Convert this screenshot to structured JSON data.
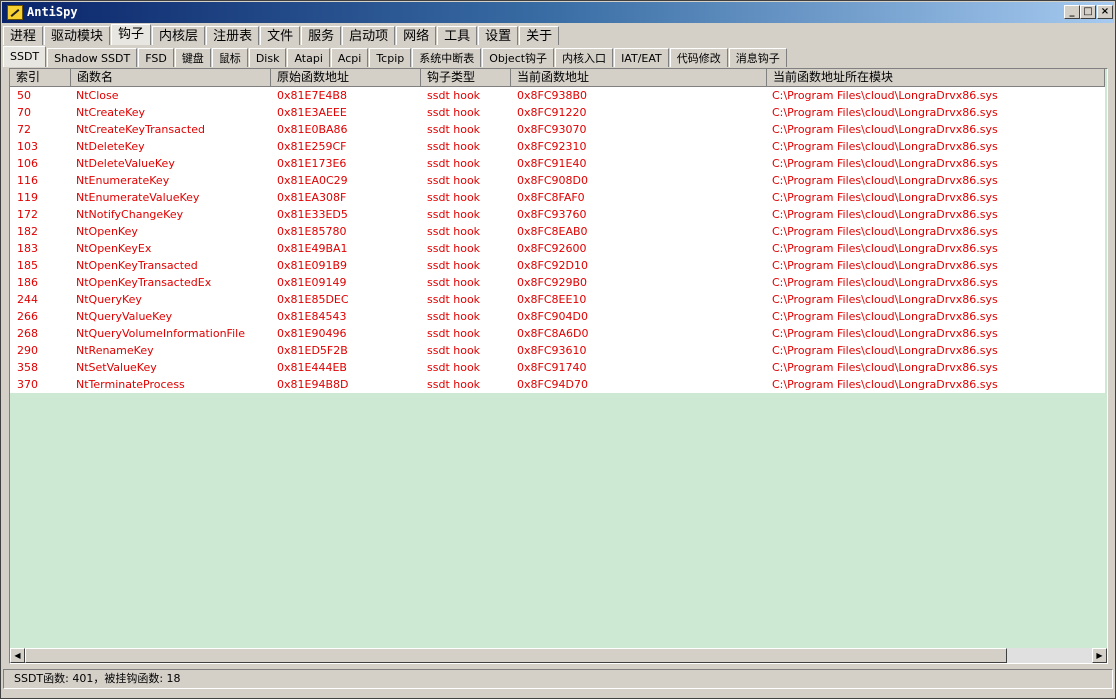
{
  "window": {
    "title": "AntiSpy"
  },
  "main_tabs": [
    {
      "label": "进程"
    },
    {
      "label": "驱动模块"
    },
    {
      "label": "钩子",
      "active": true
    },
    {
      "label": "内核层"
    },
    {
      "label": "注册表"
    },
    {
      "label": "文件"
    },
    {
      "label": "服务"
    },
    {
      "label": "启动项"
    },
    {
      "label": "网络"
    },
    {
      "label": "工具"
    },
    {
      "label": "设置"
    },
    {
      "label": "关于"
    }
  ],
  "sub_tabs": [
    {
      "label": "SSDT",
      "active": true
    },
    {
      "label": "Shadow SSDT"
    },
    {
      "label": "FSD"
    },
    {
      "label": "键盘"
    },
    {
      "label": "鼠标"
    },
    {
      "label": "Disk"
    },
    {
      "label": "Atapi"
    },
    {
      "label": "Acpi"
    },
    {
      "label": "Tcpip"
    },
    {
      "label": "系统中断表"
    },
    {
      "label": "Object钩子"
    },
    {
      "label": "内核入口"
    },
    {
      "label": "IAT/EAT"
    },
    {
      "label": "代码修改"
    },
    {
      "label": "消息钩子"
    }
  ],
  "table": {
    "columns": [
      "索引",
      "函数名",
      "原始函数地址",
      "钩子类型",
      "当前函数地址",
      "当前函数地址所在模块"
    ],
    "rows": [
      [
        "50",
        "NtClose",
        "0x81E7E4B8",
        "ssdt hook",
        "0x8FC938B0",
        "C:\\Program Files\\cloud\\LongraDrvx86.sys"
      ],
      [
        "70",
        "NtCreateKey",
        "0x81E3AEEE",
        "ssdt hook",
        "0x8FC91220",
        "C:\\Program Files\\cloud\\LongraDrvx86.sys"
      ],
      [
        "72",
        "NtCreateKeyTransacted",
        "0x81E0BA86",
        "ssdt hook",
        "0x8FC93070",
        "C:\\Program Files\\cloud\\LongraDrvx86.sys"
      ],
      [
        "103",
        "NtDeleteKey",
        "0x81E259CF",
        "ssdt hook",
        "0x8FC92310",
        "C:\\Program Files\\cloud\\LongraDrvx86.sys"
      ],
      [
        "106",
        "NtDeleteValueKey",
        "0x81E173E6",
        "ssdt hook",
        "0x8FC91E40",
        "C:\\Program Files\\cloud\\LongraDrvx86.sys"
      ],
      [
        "116",
        "NtEnumerateKey",
        "0x81EA0C29",
        "ssdt hook",
        "0x8FC908D0",
        "C:\\Program Files\\cloud\\LongraDrvx86.sys"
      ],
      [
        "119",
        "NtEnumerateValueKey",
        "0x81EA308F",
        "ssdt hook",
        "0x8FC8FAF0",
        "C:\\Program Files\\cloud\\LongraDrvx86.sys"
      ],
      [
        "172",
        "NtNotifyChangeKey",
        "0x81E33ED5",
        "ssdt hook",
        "0x8FC93760",
        "C:\\Program Files\\cloud\\LongraDrvx86.sys"
      ],
      [
        "182",
        "NtOpenKey",
        "0x81E85780",
        "ssdt hook",
        "0x8FC8EAB0",
        "C:\\Program Files\\cloud\\LongraDrvx86.sys"
      ],
      [
        "183",
        "NtOpenKeyEx",
        "0x81E49BA1",
        "ssdt hook",
        "0x8FC92600",
        "C:\\Program Files\\cloud\\LongraDrvx86.sys"
      ],
      [
        "185",
        "NtOpenKeyTransacted",
        "0x81E091B9",
        "ssdt hook",
        "0x8FC92D10",
        "C:\\Program Files\\cloud\\LongraDrvx86.sys"
      ],
      [
        "186",
        "NtOpenKeyTransactedEx",
        "0x81E09149",
        "ssdt hook",
        "0x8FC929B0",
        "C:\\Program Files\\cloud\\LongraDrvx86.sys"
      ],
      [
        "244",
        "NtQueryKey",
        "0x81E85DEC",
        "ssdt hook",
        "0x8FC8EE10",
        "C:\\Program Files\\cloud\\LongraDrvx86.sys"
      ],
      [
        "266",
        "NtQueryValueKey",
        "0x81E84543",
        "ssdt hook",
        "0x8FC904D0",
        "C:\\Program Files\\cloud\\LongraDrvx86.sys"
      ],
      [
        "268",
        "NtQueryVolumeInformationFile",
        "0x81E90496",
        "ssdt hook",
        "0x8FC8A6D0",
        "C:\\Program Files\\cloud\\LongraDrvx86.sys"
      ],
      [
        "290",
        "NtRenameKey",
        "0x81ED5F2B",
        "ssdt hook",
        "0x8FC93610",
        "C:\\Program Files\\cloud\\LongraDrvx86.sys"
      ],
      [
        "358",
        "NtSetValueKey",
        "0x81E444EB",
        "ssdt hook",
        "0x8FC91740",
        "C:\\Program Files\\cloud\\LongraDrvx86.sys"
      ],
      [
        "370",
        "NtTerminateProcess",
        "0x81E94B8D",
        "ssdt hook",
        "0x8FC94D70",
        "C:\\Program Files\\cloud\\LongraDrvx86.sys"
      ]
    ]
  },
  "status": {
    "text": "SSDT函数: 401，被挂钩函数: 18"
  },
  "colors": {
    "row_text": "#e00000",
    "empty_area": "#cde9d3"
  }
}
